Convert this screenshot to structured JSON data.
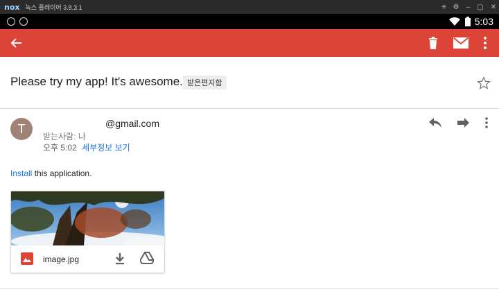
{
  "emulator": {
    "logo": "nox",
    "title": "녹스 플레이어 3.8.3.1"
  },
  "status_bar": {
    "time": "5:03"
  },
  "colors": {
    "appbar": "#db4437",
    "link": "#1a73e8",
    "avatar": "#a18276"
  },
  "email": {
    "subject": "Please try my app! It's awesome.",
    "label": "받은편지함",
    "sender_initial": "T",
    "sender_email": "@gmail.com",
    "recipients": "받는사람: 나",
    "time": "오후 5:02",
    "details_link": "세부정보 보기",
    "body_link": "Install",
    "body_text": " this application."
  },
  "attachment": {
    "name": "image.jpg"
  },
  "icons": [
    "back-arrow-icon",
    "trash-icon",
    "mail-icon",
    "more-vert-icon",
    "star-icon",
    "reply-icon",
    "forward-icon",
    "image-file-icon",
    "download-icon",
    "drive-icon"
  ]
}
